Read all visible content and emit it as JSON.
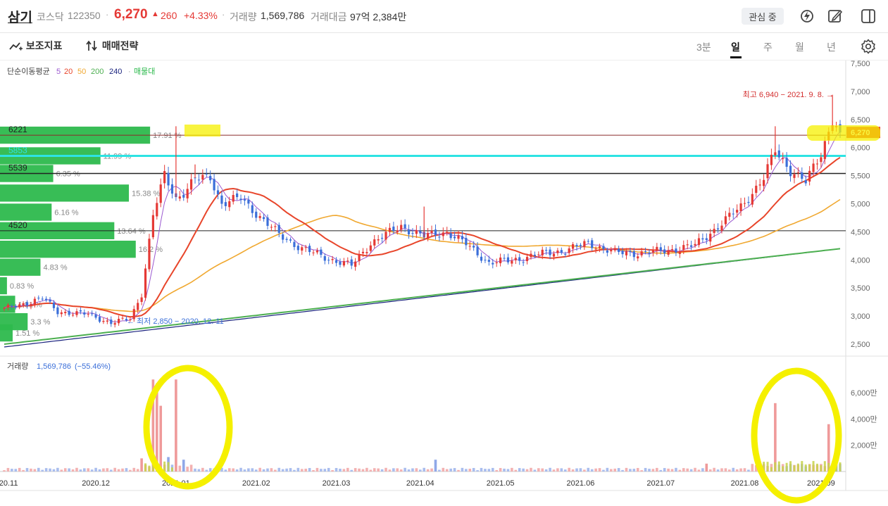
{
  "header": {
    "name": "삼기",
    "market": "코스닥",
    "code": "122350",
    "price": "6,270",
    "change": "260",
    "change_pct": "+4.33%",
    "volume_label": "거래량",
    "volume": "1,569,786",
    "amount_label": "거래대금",
    "amount": "97억 2,384만",
    "watch_label": "관심 중"
  },
  "toolbar": {
    "indicators_label": "보조지표",
    "strategy_label": "매매전략",
    "periods": [
      "3분",
      "일",
      "주",
      "월",
      "년"
    ],
    "active_period": "일"
  },
  "colors": {
    "up": "#e53935",
    "down": "#3b6fd9",
    "ma5": "#9b59d0",
    "ma20": "#e8452a",
    "ma50": "#f0a830",
    "ma200": "#4caf50",
    "ma240": "#1a237e",
    "profile": "#2db94d",
    "highlight": "#f5f000",
    "cyan": "#2de3e3"
  },
  "chart_data": {
    "type": "candlestick",
    "ma_legend": {
      "label": "단순이동평균",
      "periods": [
        "5",
        "20",
        "50",
        "200",
        "240"
      ],
      "profile_label": "매물대"
    },
    "y_ticks": [
      "7,500",
      "7,000",
      "6,500",
      "6,000",
      "5,500",
      "5,000",
      "4,500",
      "4,000",
      "3,500",
      "3,000",
      "2,500"
    ],
    "ylim": [
      2300,
      7500
    ],
    "x_ticks": [
      "2020.11",
      "2020.12",
      "2021.01",
      "2021.02",
      "2021.03",
      "2021.04",
      "2021.05",
      "2021.06",
      "2021.07",
      "2021.08",
      "2021.09"
    ],
    "current_price_tag": "6,270",
    "high_annotation": "최고 6,940 − 2021. 9. 8. →",
    "low_annotation": "← 최저 2,850 − 2020. 12. 11",
    "horizontal_lines": [
      {
        "label": "6221",
        "value": 6221
      },
      {
        "label": "5853",
        "value": 5853
      },
      {
        "label": "5539",
        "value": 5539
      },
      {
        "label": "4520",
        "value": 4520
      }
    ],
    "volume_profile": [
      {
        "price": 6221,
        "pct": "17.91 %",
        "value": 17.91
      },
      {
        "price": 5853,
        "pct": "11.99 %",
        "value": 11.99
      },
      {
        "price": 5539,
        "pct": "6.35 %",
        "value": 6.35
      },
      {
        "price": 5190,
        "pct": "15.38 %",
        "value": 15.38
      },
      {
        "price": 4850,
        "pct": "6.16 %",
        "value": 6.16
      },
      {
        "price": 4520,
        "pct": "13.64 %",
        "value": 13.64
      },
      {
        "price": 4190,
        "pct": "16.2 %",
        "value": 16.2
      },
      {
        "price": 3870,
        "pct": "4.83 %",
        "value": 4.83
      },
      {
        "price": 3540,
        "pct": "0.83 %",
        "value": 0.83
      },
      {
        "price": 3210,
        "pct": "1.81 %",
        "value": 1.81
      },
      {
        "price": 2900,
        "pct": "3.3 %",
        "value": 3.3
      },
      {
        "price": 2700,
        "pct": "1.51 %",
        "value": 1.51
      }
    ],
    "price_anchors": [
      [
        0,
        3120
      ],
      [
        5,
        3220
      ],
      [
        10,
        3320
      ],
      [
        14,
        3080
      ],
      [
        22,
        3030
      ],
      [
        28,
        2880
      ],
      [
        33,
        2950
      ],
      [
        36,
        3400
      ],
      [
        39,
        4800
      ],
      [
        42,
        5500
      ],
      [
        45,
        5100
      ],
      [
        47,
        5200
      ],
      [
        50,
        5430
      ],
      [
        54,
        5480
      ],
      [
        57,
        5000
      ],
      [
        62,
        5100
      ],
      [
        68,
        4700
      ],
      [
        72,
        4450
      ],
      [
        78,
        4200
      ],
      [
        86,
        4000
      ],
      [
        91,
        3900
      ],
      [
        96,
        4300
      ],
      [
        104,
        4600
      ],
      [
        110,
        4420
      ],
      [
        116,
        4500
      ],
      [
        121,
        4280
      ],
      [
        127,
        3950
      ],
      [
        133,
        3990
      ],
      [
        140,
        4100
      ],
      [
        147,
        4170
      ],
      [
        153,
        4300
      ],
      [
        160,
        4130
      ],
      [
        166,
        4120
      ],
      [
        174,
        4170
      ],
      [
        181,
        4260
      ],
      [
        188,
        4650
      ],
      [
        193,
        4950
      ],
      [
        199,
        5450
      ],
      [
        202,
        5950
      ],
      [
        206,
        5600
      ],
      [
        210,
        5380
      ],
      [
        214,
        5900
      ],
      [
        217,
        6500
      ],
      [
        219,
        6270
      ]
    ],
    "ma_seed": {
      "ma200": [
        2500,
        4200
      ],
      "ma240": [
        2450,
        4200
      ]
    },
    "volume": {
      "label": "거래량",
      "value": "1,569,786",
      "change": "(−55.46%)",
      "y_ticks": [
        "6,000만",
        "4,000만",
        "2,000만"
      ],
      "ymax": 7600,
      "spikes": [
        {
          "day": 39,
          "value": 7000,
          "color": "up"
        },
        {
          "day": 40,
          "value": 6700,
          "color": "up"
        },
        {
          "day": 41,
          "value": 5000,
          "color": "up"
        },
        {
          "day": 45,
          "value": 7000,
          "color": "up"
        },
        {
          "day": 202,
          "value": 5200,
          "color": "up"
        },
        {
          "day": 216,
          "value": 3600,
          "color": "up"
        },
        {
          "day": 218,
          "value": 1900,
          "color": "down"
        },
        {
          "day": 43,
          "value": 1100,
          "color": "down"
        },
        {
          "day": 47,
          "value": 900,
          "color": "down"
        },
        {
          "day": 36,
          "value": 1000,
          "color": "up"
        },
        {
          "day": 113,
          "value": 900,
          "color": "down"
        },
        {
          "day": 184,
          "value": 600,
          "color": "up"
        }
      ]
    }
  }
}
